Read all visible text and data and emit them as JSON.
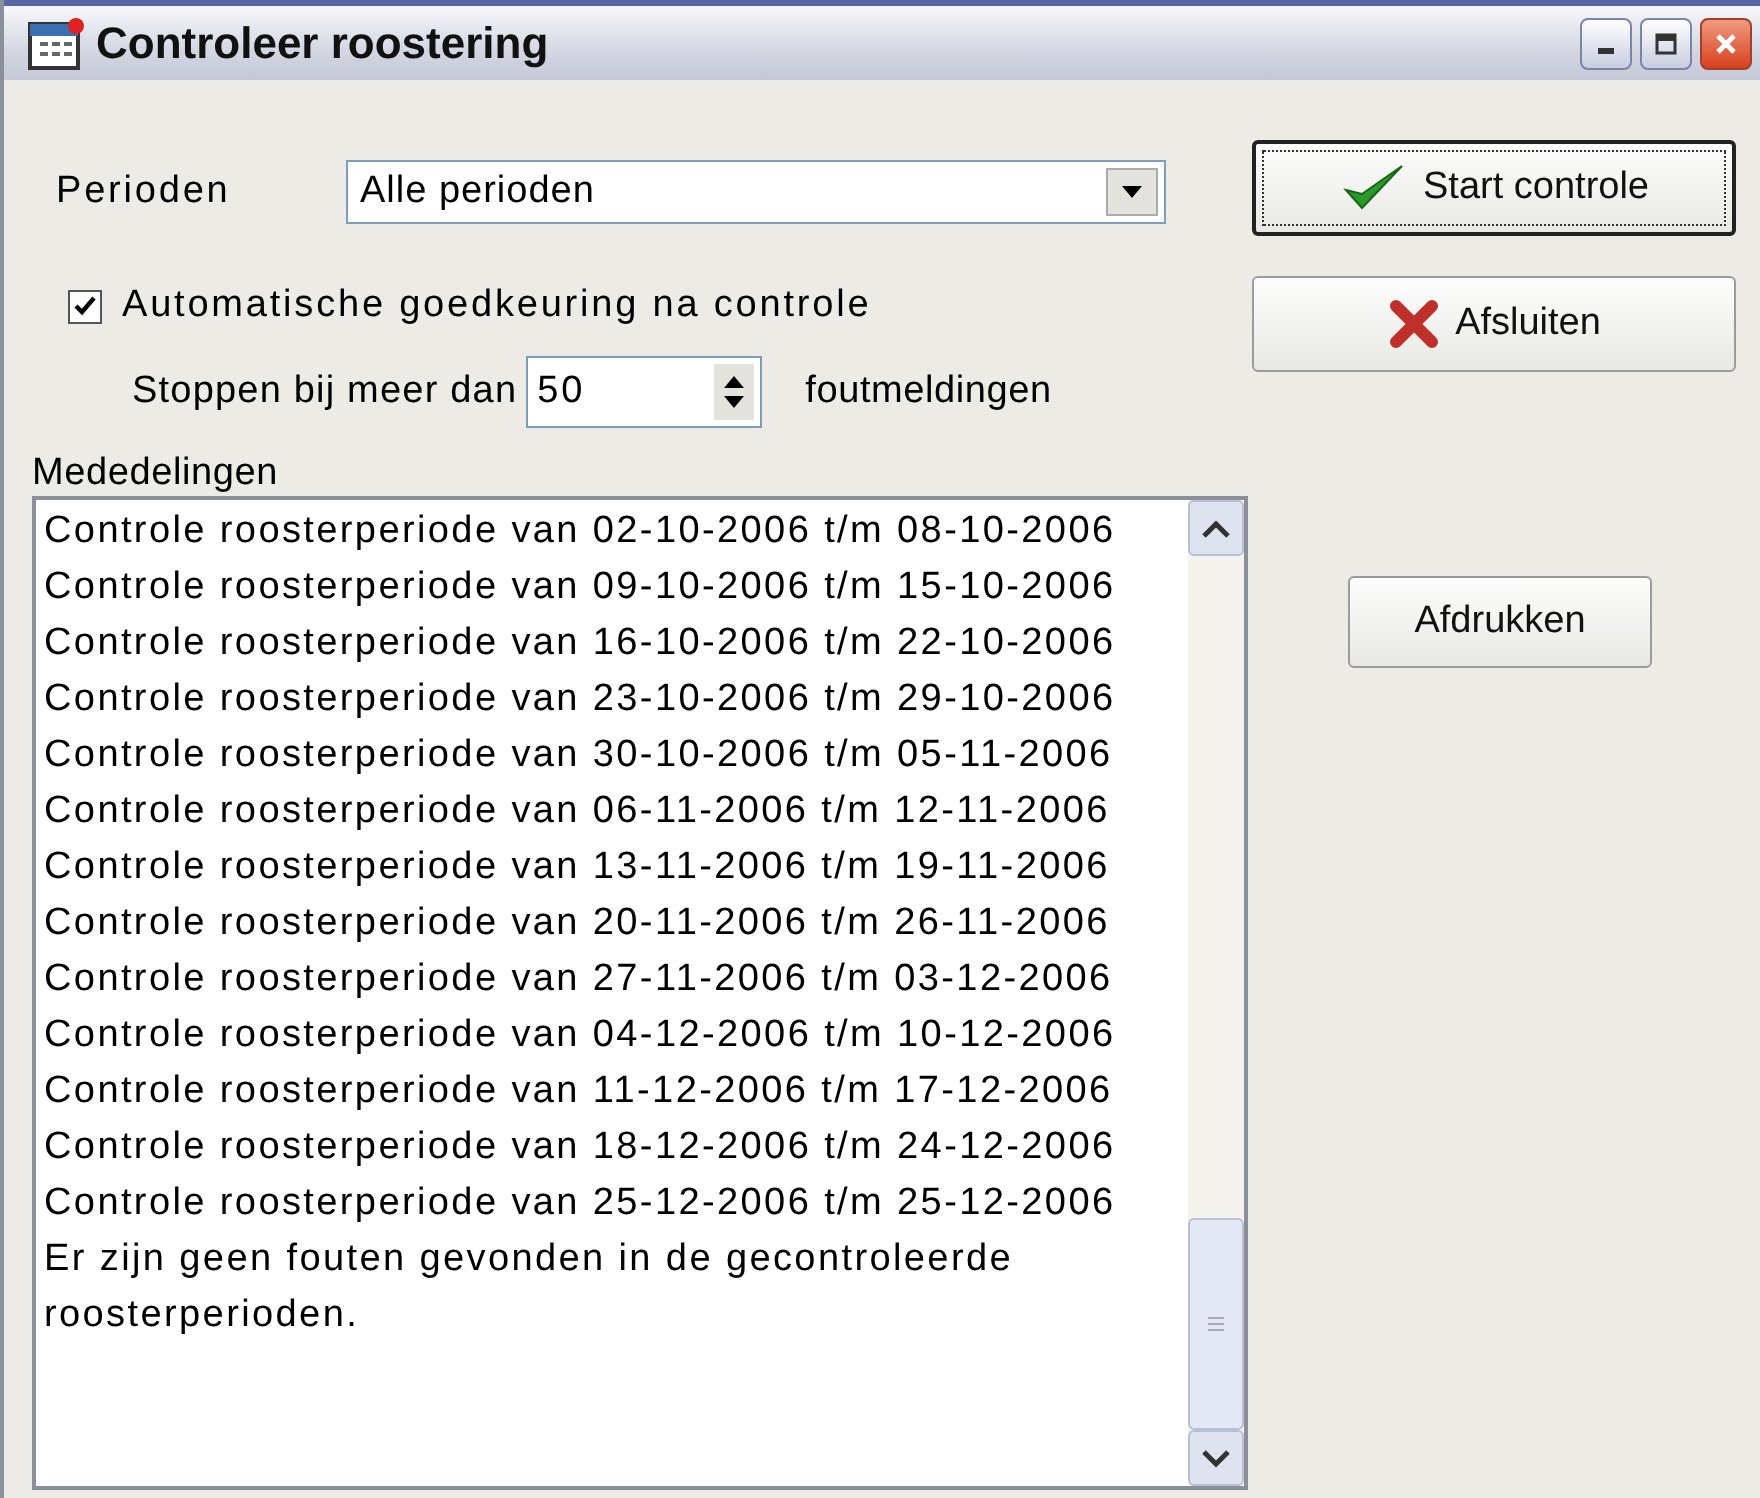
{
  "window": {
    "title": "Controleer roostering"
  },
  "periods": {
    "label": "Perioden",
    "value": "Alle perioden"
  },
  "auto_approve": {
    "label": "Automatische goedkeuring na controle",
    "checked": true
  },
  "stop": {
    "label": "Stoppen bij meer dan",
    "value": "50",
    "suffix": "foutmeldingen"
  },
  "buttons": [
    {
      "label": "Start controle",
      "kind": "check",
      "focused": true
    },
    {
      "label": "Afsluiten",
      "kind": "cross",
      "focused": false
    }
  ],
  "messages": {
    "label": "Mededelingen",
    "lines": [
      "Controle roosterperiode van 02-10-2006 t/m 08-10-2006",
      "Controle roosterperiode van 09-10-2006 t/m 15-10-2006",
      "Controle roosterperiode van 16-10-2006 t/m 22-10-2006",
      "Controle roosterperiode van 23-10-2006 t/m 29-10-2006",
      "Controle roosterperiode van 30-10-2006 t/m 05-11-2006",
      "Controle roosterperiode van 06-11-2006 t/m 12-11-2006",
      "Controle roosterperiode van 13-11-2006 t/m 19-11-2006",
      "Controle roosterperiode van 20-11-2006 t/m 26-11-2006",
      "Controle roosterperiode van 27-11-2006 t/m 03-12-2006",
      "Controle roosterperiode van 04-12-2006 t/m 10-12-2006",
      "Controle roosterperiode van 11-12-2006 t/m 17-12-2006",
      "Controle roosterperiode van 18-12-2006 t/m 24-12-2006",
      "Controle roosterperiode van 25-12-2006 t/m 25-12-2006",
      "Er zijn geen fouten gevonden in de gecontroleerde roosterperioden."
    ]
  },
  "print_button": {
    "label": "Afdrukken"
  }
}
